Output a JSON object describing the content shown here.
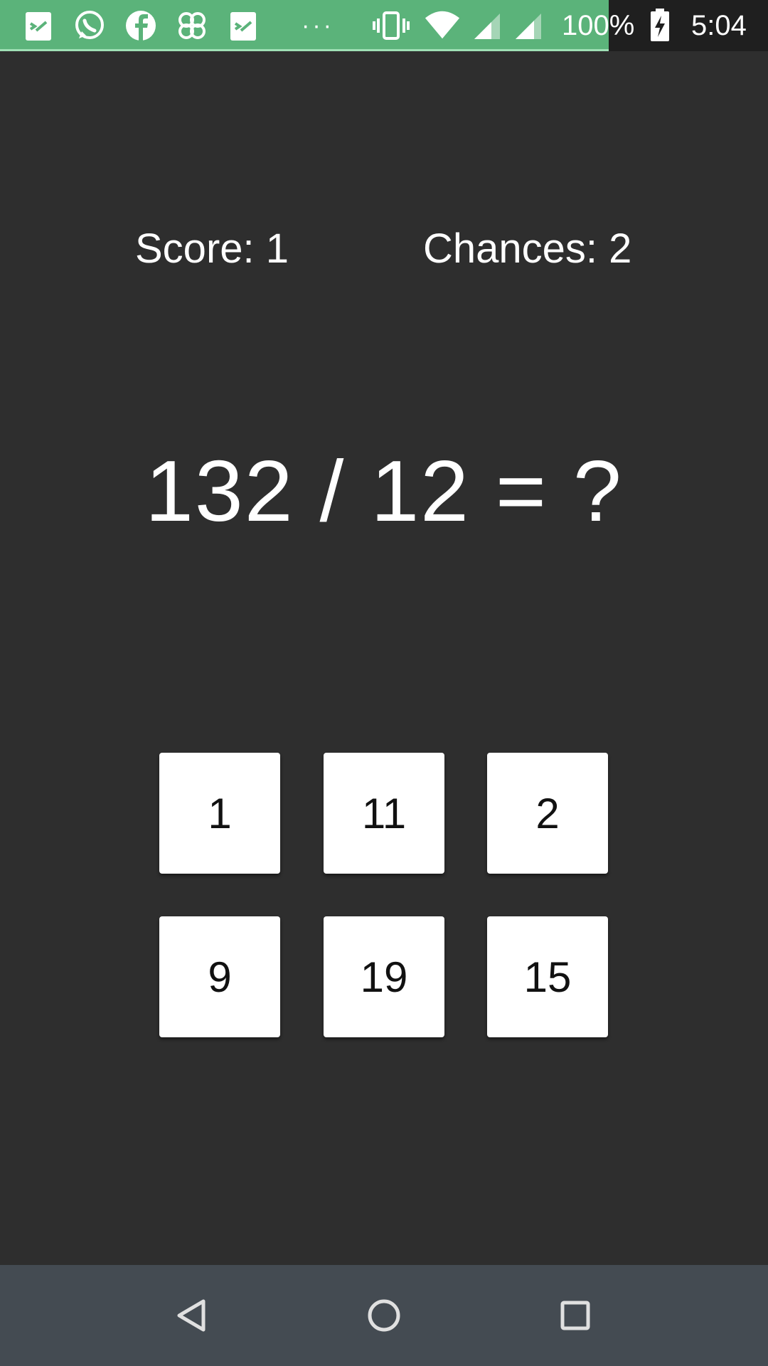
{
  "status_bar": {
    "notification_icons": [
      "notes-app-icon",
      "whatsapp-icon",
      "facebook-icon",
      "clover-app-icon",
      "notes-app-icon"
    ],
    "more_label": "···",
    "battery_percent": "100%",
    "time": "5:04",
    "accent_color": "#5bb37a"
  },
  "game": {
    "score_label": "Score: 1",
    "chances_label": "Chances: 2",
    "question": "132 / 12 = ?",
    "answers": [
      "1",
      "11",
      "2",
      "9",
      "19",
      "15"
    ]
  },
  "nav": {
    "icons": [
      "back-icon",
      "home-icon",
      "recents-icon"
    ]
  }
}
